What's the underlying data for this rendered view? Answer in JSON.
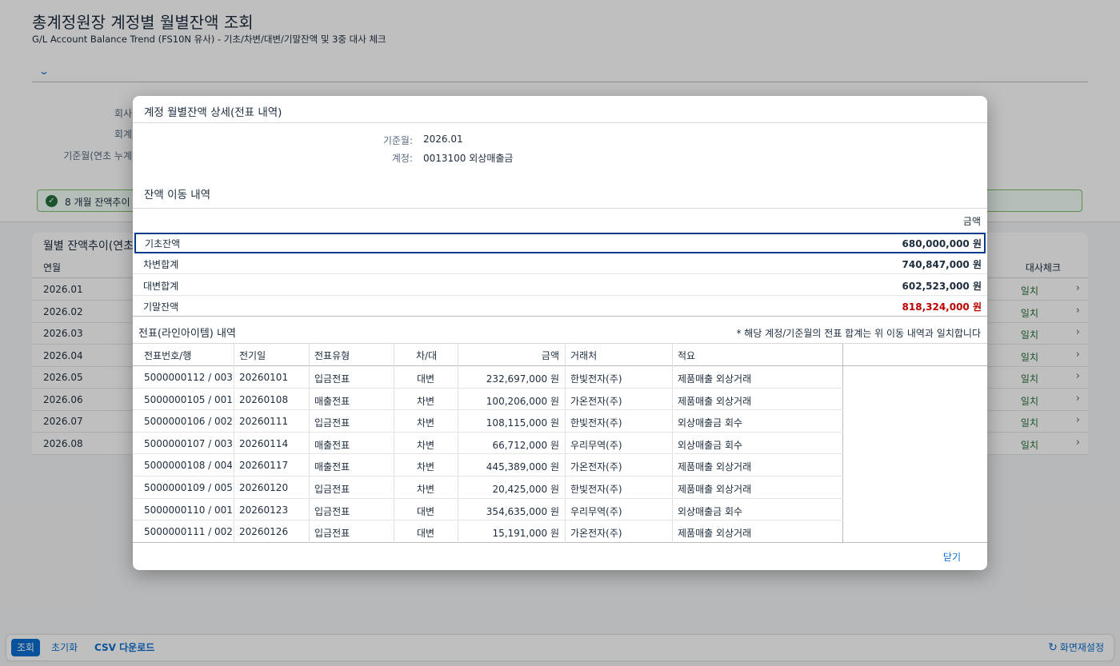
{
  "page": {
    "title": "총계정원장 계정별 월별잔액 조회",
    "subtitle": "G/L Account Balance Trend (FS10N 유사) - 기초/차변/대변/기말잔액 및 3중 대사 체크",
    "expand_icon": "chevron-down-icon",
    "filters": [
      "회사",
      "회계",
      "기준월(연초 누계"
    ],
    "message": {
      "icon": "checkmark-icon",
      "text": "8 개월 잔액추이"
    },
    "trend": {
      "title": "월별 잔액추이(연초",
      "col_month": "연월",
      "col_check": "대사체크",
      "rows": [
        {
          "month": "2026.01",
          "check": "일치"
        },
        {
          "month": "2026.02",
          "check": "일치"
        },
        {
          "month": "2026.03",
          "check": "일치"
        },
        {
          "month": "2026.04",
          "check": "일치"
        },
        {
          "month": "2026.05",
          "check": "일치"
        },
        {
          "month": "2026.06",
          "check": "일치"
        },
        {
          "month": "2026.07",
          "check": "일치"
        },
        {
          "month": "2026.08",
          "check": "일치"
        }
      ]
    }
  },
  "footer": {
    "search": "조회",
    "reset": "초기화",
    "csv": "CSV 다운로드",
    "layout_reset": "화면재설정"
  },
  "dialog": {
    "title": "계정 월별잔액 상세(전표 내역)",
    "info": [
      {
        "label": "기준월:",
        "value": "2026.01"
      },
      {
        "label": "계정:",
        "value": "0013100 외상매출금"
      }
    ],
    "movement": {
      "title": "잔액 이동 내역",
      "amount_header": "금액",
      "rows": [
        {
          "label": "기초잔액",
          "amount": "680,000,000 원"
        },
        {
          "label": "차변합계",
          "amount": "740,847,000 원"
        },
        {
          "label": "대변합계",
          "amount": "602,523,000 원"
        },
        {
          "label": "기말잔액",
          "amount": "818,324,000 원"
        }
      ],
      "negative_color": "#bb0000"
    },
    "documents": {
      "title": "전표(라인아이템) 내역",
      "note": "* 해당 계정/기준월의 전표 합계는 위 이동 내역과 일치합니다",
      "headers": [
        "전표번호/행",
        "전기일",
        "전표유형",
        "차/대",
        "금액",
        "거래처",
        "적요"
      ],
      "rows": [
        [
          "5000000112 / 003",
          "20260101",
          "입금전표",
          "대변",
          "232,697,000 원",
          "한빛전자(주)",
          "제품매출 외상거래"
        ],
        [
          "5000000105 / 001",
          "20260108",
          "매출전표",
          "차변",
          "100,206,000 원",
          "가온전자(주)",
          "제품매출 외상거래"
        ],
        [
          "5000000106 / 002",
          "20260111",
          "입금전표",
          "차변",
          "108,115,000 원",
          "한빛전자(주)",
          "외상매출금 회수"
        ],
        [
          "5000000107 / 003",
          "20260114",
          "매출전표",
          "차변",
          "66,712,000 원",
          "우리무역(주)",
          "외상매출금 회수"
        ],
        [
          "5000000108 / 004",
          "20260117",
          "매출전표",
          "차변",
          "445,389,000 원",
          "가온전자(주)",
          "제품매출 외상거래"
        ],
        [
          "5000000109 / 005",
          "20260120",
          "입금전표",
          "차변",
          "20,425,000 원",
          "한빛전자(주)",
          "제품매출 외상거래"
        ],
        [
          "5000000110 / 001",
          "20260123",
          "입금전표",
          "대변",
          "354,635,000 원",
          "우리무역(주)",
          "외상매출금 회수"
        ],
        [
          "5000000111 / 002",
          "20260126",
          "입금전표",
          "대변",
          "15,191,000 원",
          "가온전자(주)",
          "제품매출 외상거래"
        ]
      ]
    },
    "close": "닫기"
  }
}
